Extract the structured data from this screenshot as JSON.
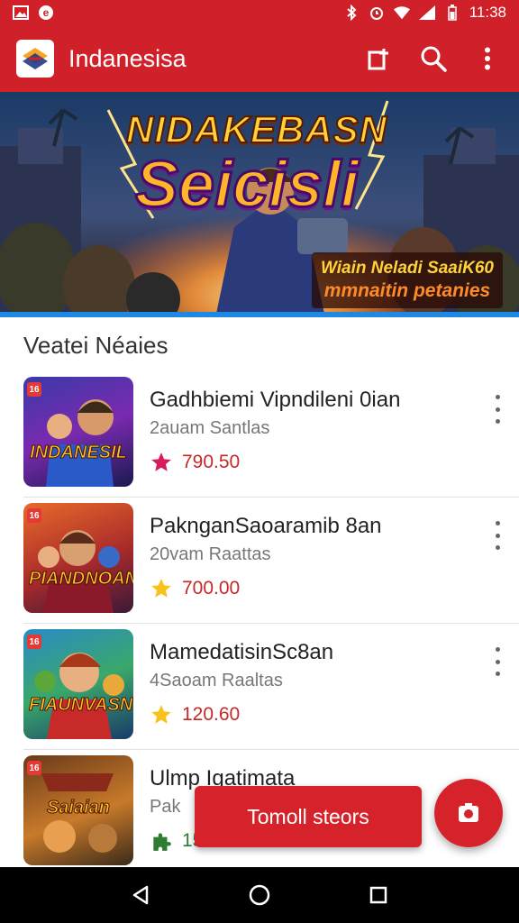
{
  "status_bar": {
    "time": "11:38"
  },
  "app_bar": {
    "title": "Indanesisa"
  },
  "banner": {
    "title_line1": "NIDAKEBASN",
    "title_line2": "Seicisli",
    "tag_line1": "Wiain Neladi SaaiK60",
    "tag_line2": "mmnaitin petanies"
  },
  "section": {
    "title": "Veatei Néaies"
  },
  "games": [
    {
      "title": "Gadhbiemi Vipndileni 0ian",
      "subtitle": "2auam Santlas",
      "rating": "790.50",
      "thumb_text": "INDANESIL",
      "icon": "star-icon",
      "icon_color": "#d81b60"
    },
    {
      "title": "PaknganSaoaramib 8an",
      "subtitle": "20vam Raattas",
      "rating": "700.00",
      "thumb_text": "PIANDNOAN",
      "icon": "star-icon",
      "icon_color": "#f9c21a"
    },
    {
      "title": "MamedatisinSc8an",
      "subtitle": "4Saoam Raaltas",
      "rating": "120.60",
      "thumb_text": "FIAUNVASN",
      "icon": "star-icon",
      "icon_color": "#f9c21a"
    },
    {
      "title": "Ulmp Igatimata",
      "subtitle": "Pak",
      "rating": "15",
      "thumb_text": "Saiaian",
      "icon": "puzzle-icon",
      "icon_color": "#2e7d32"
    }
  ],
  "snackbar": {
    "label": "Tomoll steors"
  }
}
